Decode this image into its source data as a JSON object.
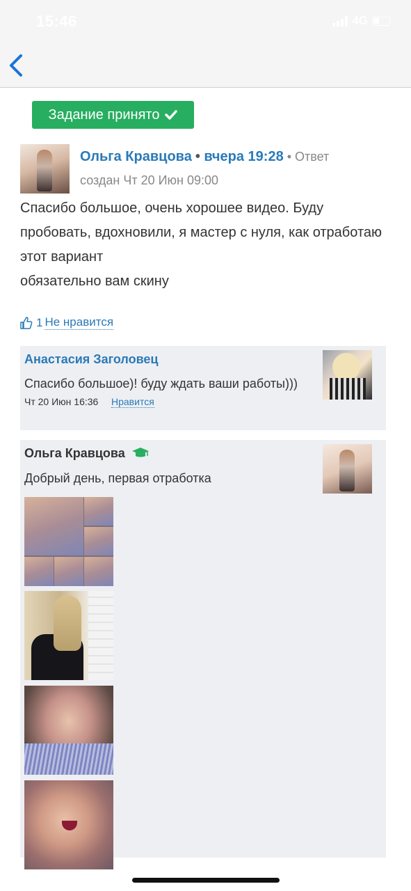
{
  "status_bar": {
    "time": "15:46",
    "network": "4G"
  },
  "nav": {
    "back_icon": "chevron-left-icon"
  },
  "badge": {
    "label": "Задание принято",
    "icon": "checkmark-icon",
    "color": "#27ae60"
  },
  "comment": {
    "author": "Ольга Кравцова",
    "date": "вчера 19:28",
    "meta_suffix": "• Ответ создан Чт 20 Июн 09:00",
    "text": "Спасибо большое, очень хорошее видео. Буду пробовать, вдохновили, я мастер с нуля, как отработаю этот вариант\nобязательно вам скину",
    "likes": {
      "icon": "thumbs-up-icon",
      "count": "1",
      "dislike_label": "Не нравится"
    }
  },
  "replies": [
    {
      "author": "Анастасия Заголовец",
      "text": "Спасибо большое)! буду ждать ваши работы)))",
      "date": "Чт 20 Июн 16:36",
      "like_label": "Нравится"
    },
    {
      "author": "Ольга Кравцова",
      "author_icon": "graduation-cap-icon",
      "text": "Добрый день, первая отработка",
      "photos": [
        "collage",
        "back-view",
        "portrait-1",
        "portrait-2"
      ]
    }
  ],
  "colors": {
    "link": "#2a7ab8",
    "reply_bg": "#eeeff3",
    "success": "#27ae60"
  }
}
